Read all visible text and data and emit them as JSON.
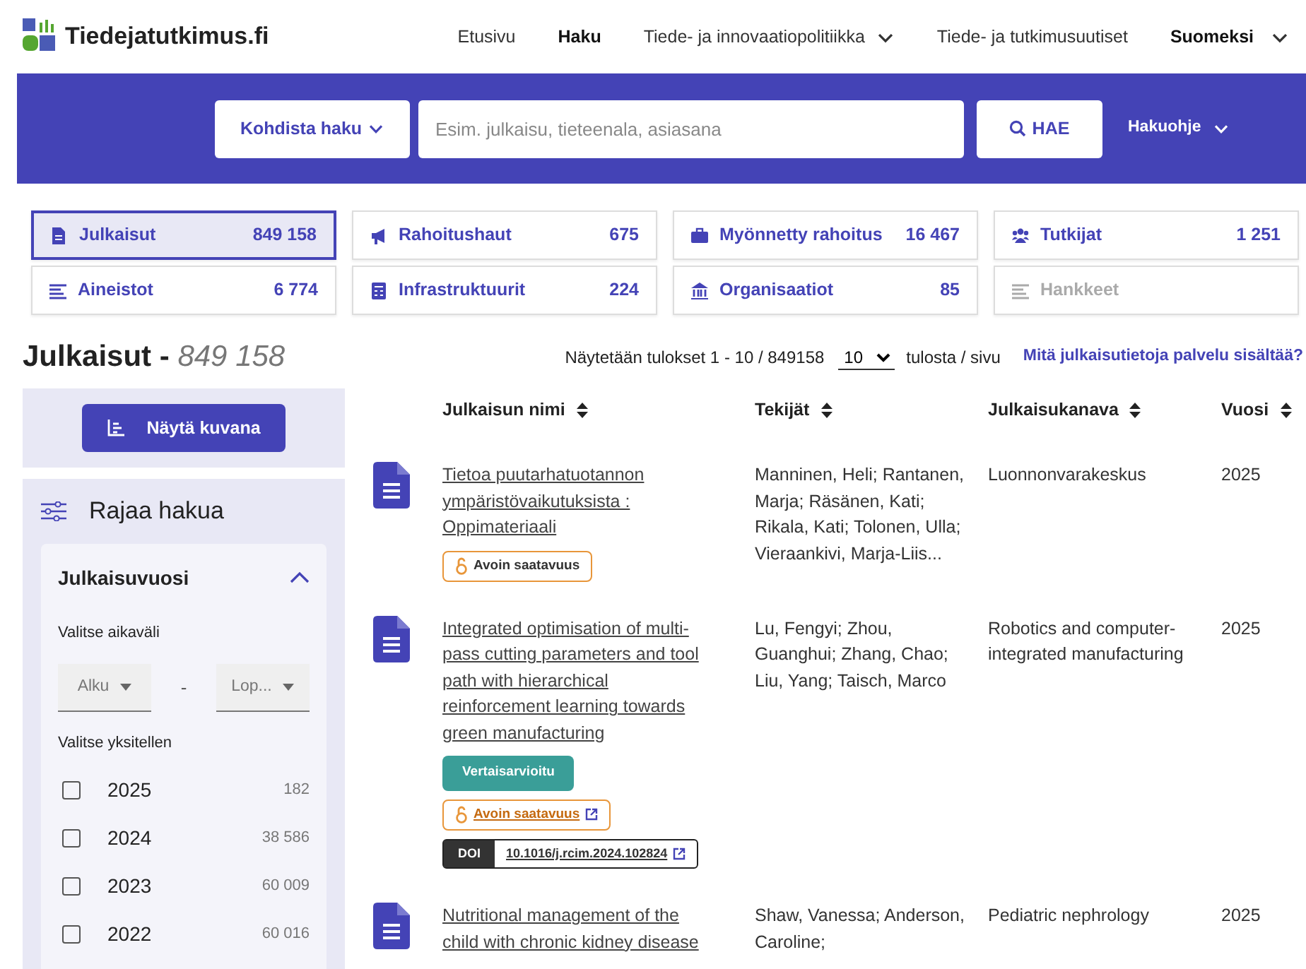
{
  "header": {
    "logo_text": "Tiedejatutkimus.fi",
    "nav": [
      {
        "label": "Etusivu",
        "selected": false,
        "dropdown": false
      },
      {
        "label": "Haku",
        "selected": true,
        "dropdown": false
      },
      {
        "label": "Tiede- ja innovaatiopolitiikka",
        "selected": false,
        "dropdown": true
      },
      {
        "label": "Tiede- ja tutkimusuutiset",
        "selected": false,
        "dropdown": false
      }
    ],
    "language": {
      "label": "Suomeksi"
    }
  },
  "search": {
    "scope_button": "Kohdista haku",
    "placeholder": "Esim. julkaisu, tieteenala, asiasana",
    "submit_label": "HAE",
    "help_label": "Hakuohje"
  },
  "categories": [
    {
      "label": "Julkaisut",
      "count": "849 158",
      "selected": true,
      "disabled": false
    },
    {
      "label": "Rahoitushaut",
      "count": "675",
      "selected": false,
      "disabled": false
    },
    {
      "label": "Myönnetty rahoitus",
      "count": "16 467",
      "selected": false,
      "disabled": false
    },
    {
      "label": "Tutkijat",
      "count": "1 251",
      "selected": false,
      "disabled": false
    },
    {
      "label": "Aineistot",
      "count": "6 774",
      "selected": false,
      "disabled": false
    },
    {
      "label": "Infrastruktuurit",
      "count": "224",
      "selected": false,
      "disabled": false
    },
    {
      "label": "Organisaatiot",
      "count": "85",
      "selected": false,
      "disabled": false
    },
    {
      "label": "Hankkeet",
      "selected": false,
      "disabled": true
    }
  ],
  "results_heading": {
    "title": "Julkaisut - ",
    "count": "849 158"
  },
  "results_info": {
    "text": "Näytetään tulokset 1 - 10 / 849158",
    "page_size": "10",
    "per_page_label": "tulosta / sivu",
    "help_link": "Mitä julkaisutietoja palvelu sisältää?"
  },
  "sidebar": {
    "show_chart_button": "Näytä kuvana",
    "filter_title": "Rajaa hakua",
    "facet": {
      "title": "Julkaisuvuosi",
      "expanded": true,
      "range_label": "Valitse aikaväli",
      "start_placeholder": "Alku",
      "separator": "-",
      "end_placeholder": "Lop...",
      "single_label": "Valitse yksitellen",
      "years": [
        {
          "year": "2025",
          "count": "182",
          "checked": false
        },
        {
          "year": "2024",
          "count": "38 586",
          "checked": false
        },
        {
          "year": "2023",
          "count": "60 009",
          "checked": false
        },
        {
          "year": "2022",
          "count": "60 016",
          "checked": false
        }
      ]
    }
  },
  "table": {
    "columns": [
      {
        "label": "Julkaisun nimi"
      },
      {
        "label": "Tekijät"
      },
      {
        "label": "Julkaisukanava"
      },
      {
        "label": "Vuosi"
      }
    ],
    "rows": [
      {
        "title": "Tietoa puutarhatuotannon ympäristövaikutuksista : Oppimateriaali",
        "authors": "Manninen, Heli; Rantanen, Marja; Räsänen, Kati; Rikala, Kati; Tolonen, Ulla; Vieraankivi, Marja-Liis...",
        "channel": "Luonnonvarakeskus",
        "year": "2025",
        "badges": [
          {
            "kind": "open_access",
            "label": "Avoin saatavuus",
            "linked": false
          }
        ]
      },
      {
        "title": "Integrated optimisation of multi-pass cutting parameters and tool path with hierarchical reinforcement learning towards green manufacturing",
        "authors": "Lu, Fengyi; Zhou, Guanghui; Zhang, Chao; Liu, Yang; Taisch, Marco",
        "channel": "Robotics and computer-integrated manufacturing",
        "year": "2025",
        "badges": [
          {
            "kind": "peer_reviewed",
            "label": "Vertaisarvioitu"
          },
          {
            "kind": "open_access",
            "label": "Avoin saatavuus",
            "linked": true
          },
          {
            "kind": "doi",
            "prefix": "DOI",
            "label": "10.1016/j.rcim.2024.102824"
          }
        ]
      },
      {
        "title": "Nutritional management of the child with chronic kidney disease",
        "authors": "Shaw, Vanessa; Anderson, Caroline;",
        "channel": "Pediatric nephrology",
        "year": "2025",
        "badges": []
      }
    ]
  }
}
